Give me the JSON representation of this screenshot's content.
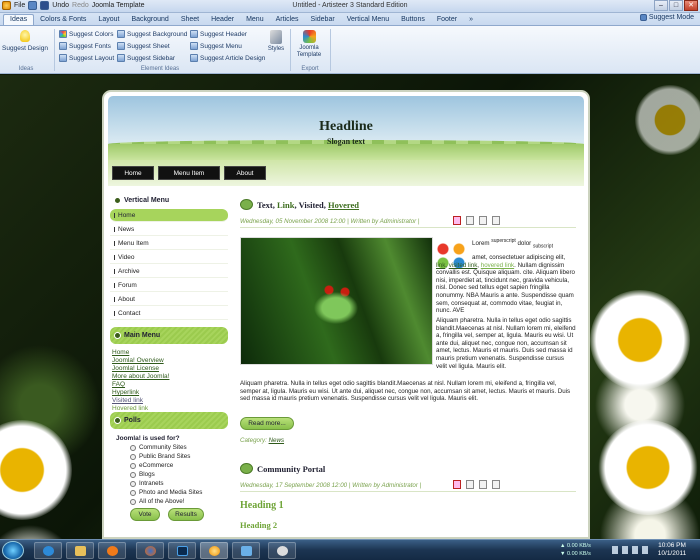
{
  "window": {
    "title": "Untitled - Artisteer 3 Standard Edition",
    "file_menu": "File",
    "undo": "Undo",
    "redo": "Redo",
    "template_menu": "Joomla Template"
  },
  "tabs": [
    "Ideas",
    "Colors & Fonts",
    "Layout",
    "Background",
    "Sheet",
    "Header",
    "Menu",
    "Articles",
    "Sidebar",
    "Vertical Menu",
    "Buttons",
    "Footer",
    "»"
  ],
  "suggest_mode": "Suggest Mode",
  "ribbon": {
    "suggest_design": "Suggest Design",
    "ideas_label": "Ideas",
    "col1": [
      "Suggest Colors",
      "Suggest Fonts",
      "Suggest Layout"
    ],
    "col2": [
      "Suggest Background",
      "Suggest Sheet",
      "Suggest Sidebar"
    ],
    "col3": [
      "Suggest Header",
      "Suggest Menu",
      "Suggest Article Design"
    ],
    "element_ideas_label": "Element Ideas",
    "styles": "Styles",
    "joomla_template": "Joomla Template",
    "export_label": "Export"
  },
  "site": {
    "headline": "Headline",
    "slogan": "Slogan text",
    "nav": [
      "Home",
      "Menu Item",
      "About"
    ],
    "vertical_menu_title": "Vertical Menu",
    "vertical_menu": [
      "Home",
      "News",
      "Menu Item",
      "Video",
      "Archive",
      "Forum",
      "About",
      "Contact"
    ],
    "main_menu_title": "Main Menu",
    "main_menu": [
      "Home",
      "Joomla! Overview",
      "Joomla! License",
      "More about Joomla!",
      "FAQ",
      "Hyperlink",
      "Visited link",
      "Hovered link"
    ],
    "polls_title": "Polls",
    "poll_question": "Joomla! is used for?",
    "poll_options": [
      "Community Sites",
      "Public Brand Sites",
      "eCommerce",
      "Blogs",
      "Intranets",
      "Photo and Media Sites",
      "All of the Above!"
    ],
    "vote": "Vote",
    "results": "Results",
    "article1": {
      "title_plain": "Text, ",
      "title_link": "Link",
      "title_visited": ", Visited, ",
      "title_hovered": "Hovered",
      "meta": "Wednesday, 05 November 2008 12:00 | Written by Administrator |",
      "lorem": "Lorem",
      "superscript": "superscript",
      "dolor": "dolor",
      "subscript": "subscript",
      "amet": "amet, consectetuer adipiscing elit,",
      "link": "link",
      "visited": "visited link",
      "hovered": "hovered link",
      "para1_rest": ". Nullam dignissim convallis est. Quisque aliquam. cite. Aliquam libero nisi, imperdiet at, tincidunt nec, gravida vehicula, nisl. Donec sed tellus eget sapien fringilla nonummy. NBA Mauris a ante. Suspendisse quam sem, consequat at, commodo vitae, feugiat in, nunc. AVE",
      "para2": "Aliquam pharetra. Nulla in tellus eget odio sagittis blandit.Maecenas at nisl. Nullam lorem mi, eleifend a, fringilla vel, semper at, ligula. Mauris eu wisi. Ut ante dui, aliquet nec, congue non, accumsan sit amet, lectus. Mauris et mauris. Duis sed massa id mauris pretium venenatis. Suspendisse cursus velit vel ligula. Mauris elit.",
      "para3": "Aliquam pharetra. Nulla in tellus eget odio sagittis blandit.Maecenas at nisl. Nullam lorem mi, eleifend a, fringilla vel, semper at, ligula. Mauris eu wisi. Ut ante dui, aliquet nec, congue non, accumsan sit amet, lectus. Mauris et mauris. Duis sed massa id mauris pretium venenatis. Suspendisse cursus velit vel ligula. Mauris elit.",
      "read_more": "Read more...",
      "category_label": "Category:",
      "category": "News"
    },
    "article2": {
      "title": "Community Portal",
      "meta": "Wednesday, 17 September 2008 12:00 | Written by Administrator |",
      "heading1": "Heading 1",
      "heading2": "Heading 2"
    }
  },
  "taskbar": {
    "net_up": "0.00 KB/s",
    "net_down": "0.00 KB/s",
    "time": "10:06 PM",
    "date": "10/1/2011"
  }
}
